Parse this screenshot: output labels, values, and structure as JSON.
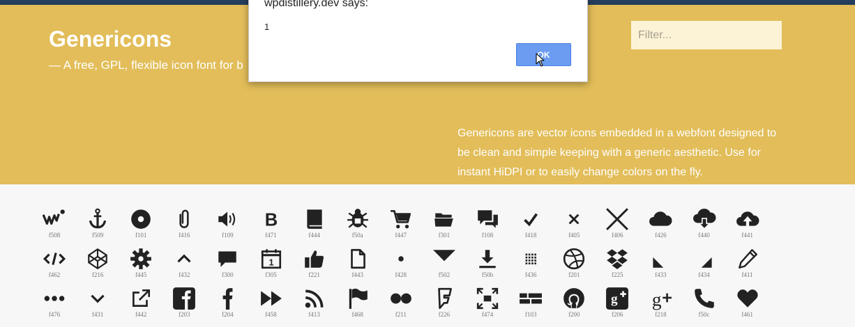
{
  "header": {
    "title": "Genericons",
    "tagline": "— A free, GPL, flexible icon font for b",
    "filter_placeholder": "Filter...",
    "description": "Genericons are vector icons embedded in a webfont designed to be clean and simple keeping with a generic aesthetic. Use for instant HiDPI or to easily change colors on the fly."
  },
  "dialog": {
    "title": "wpdistillery.dev says:",
    "message": "1",
    "ok_label": "OK"
  },
  "colors": {
    "hero": "#e2bd59",
    "topbar": "#253e5e",
    "icon": "#222222",
    "ok_button": "#6b9cf2"
  },
  "icon_rows": [
    [
      {
        "name": "wordpress",
        "code": "f508"
      },
      {
        "name": "anchor",
        "code": "f509"
      },
      {
        "name": "record",
        "code": "f101"
      },
      {
        "name": "attachment",
        "code": "f416"
      },
      {
        "name": "audio",
        "code": "f109"
      },
      {
        "name": "bold",
        "code": "f471"
      },
      {
        "name": "book",
        "code": "f444"
      },
      {
        "name": "bug",
        "code": "f50a"
      },
      {
        "name": "cart",
        "code": "f447"
      },
      {
        "name": "category",
        "code": "f301"
      },
      {
        "name": "chat",
        "code": "f108"
      },
      {
        "name": "checkmark",
        "code": "f418"
      },
      {
        "name": "close",
        "code": "f405"
      },
      {
        "name": "close-alt",
        "code": "f406"
      },
      {
        "name": "cloud",
        "code": "f426"
      },
      {
        "name": "cloud-download",
        "code": "f440"
      },
      {
        "name": "cloud-upload",
        "code": "f441"
      }
    ],
    [
      {
        "name": "code",
        "code": "f462"
      },
      {
        "name": "codepen",
        "code": "f216"
      },
      {
        "name": "cog",
        "code": "f445"
      },
      {
        "name": "collapse",
        "code": "f432"
      },
      {
        "name": "comment",
        "code": "f300"
      },
      {
        "name": "day",
        "code": "f305"
      },
      {
        "name": "digg",
        "code": "f221"
      },
      {
        "name": "document",
        "code": "f443"
      },
      {
        "name": "dot",
        "code": "f428"
      },
      {
        "name": "downarrow",
        "code": "f502"
      },
      {
        "name": "download",
        "code": "f50b"
      },
      {
        "name": "draggable",
        "code": "f436"
      },
      {
        "name": "dribbble",
        "code": "f201"
      },
      {
        "name": "dropbox",
        "code": "f225"
      },
      {
        "name": "dropdown",
        "code": "f433"
      },
      {
        "name": "dropdown-left",
        "code": "f434"
      },
      {
        "name": "edit",
        "code": "f411"
      }
    ],
    [
      {
        "name": "ellipsis",
        "code": "f476"
      },
      {
        "name": "expand",
        "code": "f431"
      },
      {
        "name": "external",
        "code": "f442"
      },
      {
        "name": "facebook",
        "code": "f203"
      },
      {
        "name": "facebook-alt",
        "code": "f204"
      },
      {
        "name": "fastforward",
        "code": "f458"
      },
      {
        "name": "feed",
        "code": "f413"
      },
      {
        "name": "flag",
        "code": "f468"
      },
      {
        "name": "flickr",
        "code": "f211"
      },
      {
        "name": "foursquare",
        "code": "f226"
      },
      {
        "name": "fullscreen",
        "code": "f474"
      },
      {
        "name": "gallery",
        "code": "f103"
      },
      {
        "name": "github",
        "code": "f200"
      },
      {
        "name": "googleplus",
        "code": "f206"
      },
      {
        "name": "googleplus-alt",
        "code": "f218"
      },
      {
        "name": "handset",
        "code": "f50c"
      },
      {
        "name": "heart",
        "code": "f461"
      }
    ]
  ]
}
